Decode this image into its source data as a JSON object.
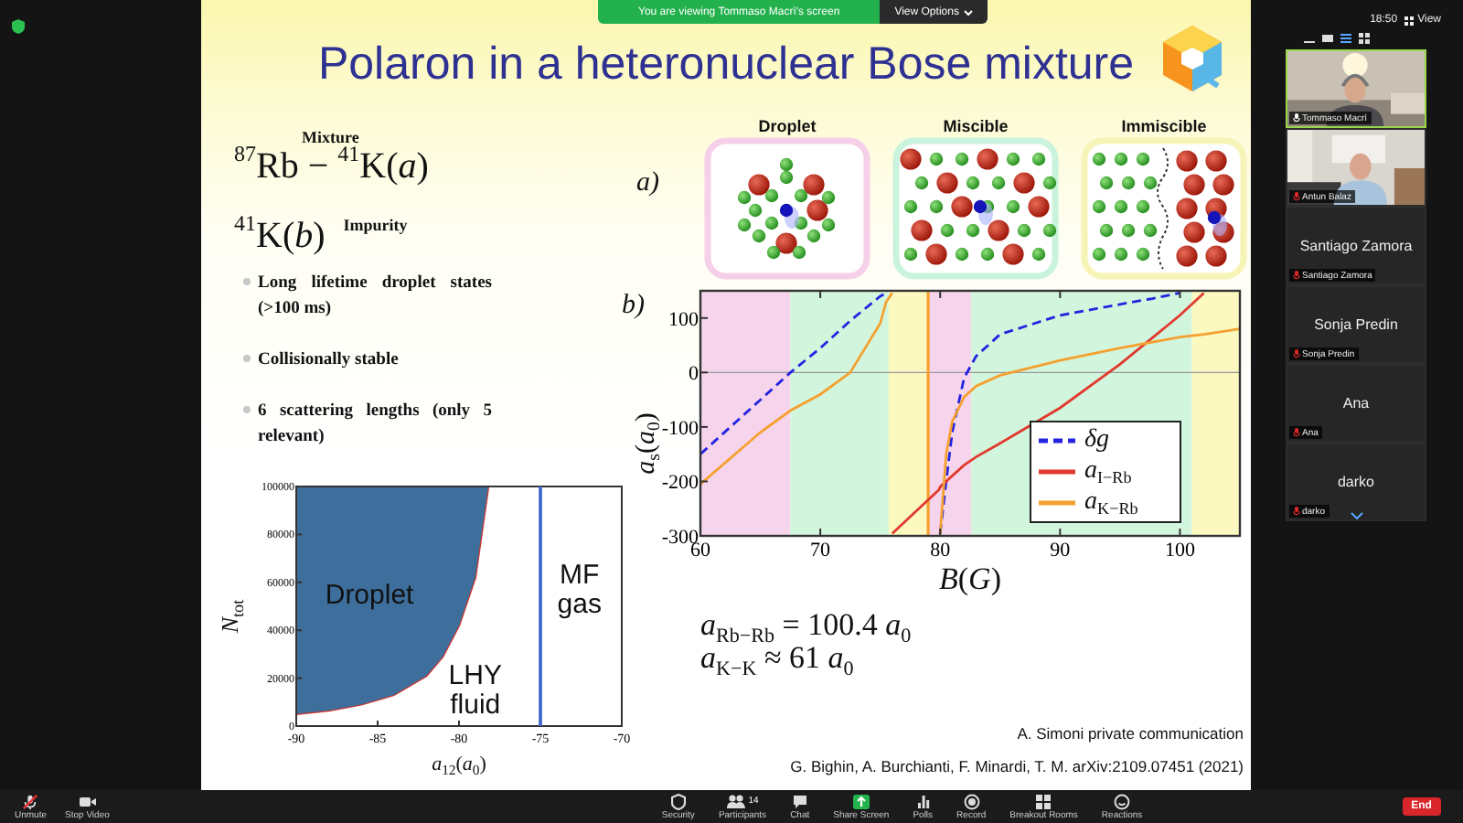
{
  "meeting": {
    "banner": "You are viewing Tommaso Macrì's screen",
    "view_options": "View Options",
    "time": "18:50",
    "view_button": "View"
  },
  "slide": {
    "title": "Polaron in a heteronuclear Bose mixture",
    "mixture_label": "Mixture",
    "mixture_formula": "$^{87}$Rb − $^{41}$K(*a*)",
    "impurity_formula": "$^{41}$K(*b*)",
    "impurity_label": "Impurity",
    "bullets": [
      "Long lifetime droplet states (>100 ms)",
      "Collisionally stable",
      "6 scattering lengths (only 5 relevant)"
    ],
    "phase_diagram": {
      "region_label": "MF gas",
      "chart_data": {
        "type": "area",
        "stacked": true,
        "xlabel": "*a*$_{12}$(*a*$_{0}$)",
        "ylabel": "*N*$_{tot}$",
        "x": [
          -90,
          -88,
          -86,
          -84,
          -82,
          -81,
          -80,
          -79,
          -78.2
        ],
        "series": [
          {
            "name": "LHY fluid",
            "color": "#ffffff",
            "values": [
              5000,
              6500,
              9000,
              13000,
              21000,
              29000,
              42000,
              62000,
              100000
            ]
          },
          {
            "name": "Droplet",
            "color": "#3d6e9c",
            "values": [
              95000,
              93500,
              91000,
              87000,
              79000,
              71000,
              58000,
              38000,
              0
            ]
          }
        ],
        "xlim": [
          -90,
          -70
        ],
        "ylim": [
          0,
          100000
        ],
        "xticks": [
          -90,
          -85,
          -80,
          -75,
          -70
        ],
        "yticks": [
          0,
          20000,
          40000,
          60000,
          80000,
          100000
        ],
        "ref_lines": [
          {
            "axis": "x",
            "value": -75,
            "color": "#3a63c8"
          }
        ]
      }
    },
    "panel_a_label": "a)",
    "illustrations": [
      {
        "label": "Droplet",
        "kind": "droplet",
        "color": "#f6cfe8"
      },
      {
        "label": "Miscible",
        "kind": "miscible",
        "color": "#c9f3dc"
      },
      {
        "label": "Immiscible",
        "kind": "immiscible",
        "color": "#f7f4b8"
      }
    ],
    "panel_b_label": "b)",
    "scattering_plot": {
      "chart_data": {
        "type": "line",
        "xlabel": "*B*(*G*)",
        "ylabel": "*a*$_{s}$(*a*$_{0}$)",
        "x": [
          60,
          65,
          67.5,
          70,
          72.5,
          75,
          75.5,
          76,
          79.9,
          80,
          80.5,
          81,
          82,
          83,
          85,
          90,
          95,
          97.5,
          100,
          102,
          105
        ],
        "series": [
          {
            "name": "*δg*",
            "color": "#2424e0",
            "line_style": "dashed",
            "values": [
              -150,
              -50,
              0,
              45,
              95,
              140,
              146,
              null,
              null,
              -296,
              -200,
              -110,
              -10,
              30,
              70,
              105,
              125,
              135,
              146,
              null,
              null
            ]
          },
          {
            "name": "*a*$_{I−Rb}$",
            "color": "#e2392e",
            "line_style": "solid",
            "values": [
              null,
              null,
              null,
              null,
              null,
              null,
              null,
              -296,
              -215,
              -210,
              -200,
              -190,
              -170,
              -155,
              -130,
              -65,
              15,
              60,
              105,
              146,
              null
            ]
          },
          {
            "name": "*a*$_{K−Rb}$",
            "color": "#f5a030",
            "line_style": "solid",
            "values": [
              -205,
              -110,
              -70,
              -40,
              0,
              90,
              130,
              146,
              null,
              -296,
              -150,
              -90,
              -45,
              -25,
              -5,
              22,
              45,
              55,
              65,
              70,
              80
            ]
          }
        ],
        "xlim": [
          60,
          105
        ],
        "ylim": [
          -300,
          150
        ],
        "xticks": [
          60,
          70,
          80,
          90,
          100
        ],
        "yticks": [
          -300,
          -200,
          -100,
          0,
          100
        ],
        "bands": [
          {
            "axis": "x",
            "from": 60,
            "to": 67.5,
            "color": "#f6d5ec"
          },
          {
            "axis": "x",
            "from": 67.5,
            "to": 75.7,
            "color": "#d2f6dd"
          },
          {
            "axis": "x",
            "from": 75.7,
            "to": 79,
            "color": "#fbf8c0"
          },
          {
            "axis": "x",
            "from": 79,
            "to": 82.6,
            "color": "#f6d5ec"
          },
          {
            "axis": "x",
            "from": 82.6,
            "to": 101,
            "color": "#d2f6dd"
          },
          {
            "axis": "x",
            "from": 101,
            "to": 105,
            "color": "#fbf8c0"
          }
        ],
        "ref_lines": [
          {
            "axis": "x",
            "value": 79,
            "color": "#f5a030"
          }
        ]
      }
    },
    "formulas": [
      "*a*$_{Rb−Rb}$ = 100.4 *a*$_{0}$",
      "*a*$_{K−K}$ ≈ 61 *a*$_{0}$"
    ],
    "credit": "A. Simoni private communication",
    "citation": "G. Bighin, A. Burchianti, F. Minardi, T. M. arXiv:2109.07451 (2021)"
  },
  "participants": [
    {
      "tag": "Tommaso Macrì",
      "kind": "video",
      "muted": false,
      "speaking": true
    },
    {
      "tag": "Antun Balaz",
      "kind": "video",
      "muted": true,
      "speaking": false
    },
    {
      "name": "Santiago Zamora",
      "tag": "Santiago Zamora",
      "kind": "name",
      "muted": true,
      "speaking": false
    },
    {
      "name": "Sonja Predin",
      "tag": "Sonja Predin",
      "kind": "name",
      "muted": true,
      "speaking": false
    },
    {
      "name": "Ana",
      "tag": "Ana",
      "kind": "name",
      "muted": true,
      "speaking": false
    },
    {
      "name": "darko",
      "tag": "darko",
      "kind": "name",
      "muted": true,
      "speaking": false
    }
  ],
  "toolbar": {
    "left": [
      {
        "label": "Unmute",
        "kind": "mic"
      },
      {
        "label": "Stop Video",
        "kind": "video"
      }
    ],
    "center": [
      {
        "label": "Security",
        "kind": "shield"
      },
      {
        "label": "Participants",
        "kind": "people",
        "badge": "14"
      },
      {
        "label": "Chat",
        "kind": "chat"
      },
      {
        "label": "Share Screen",
        "kind": "share"
      },
      {
        "label": "Polls",
        "kind": "polls"
      },
      {
        "label": "Record",
        "kind": "record"
      },
      {
        "label": "Breakout Rooms",
        "kind": "rooms"
      },
      {
        "label": "Reactions",
        "kind": "reactions"
      }
    ],
    "end": "End"
  }
}
